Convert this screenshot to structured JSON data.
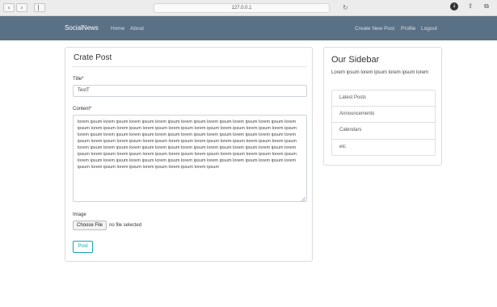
{
  "browser": {
    "url": "127.0.0.1",
    "back_glyph": "‹",
    "forward_glyph": "›",
    "reload_glyph": "↻",
    "icons": [
      "download-icon",
      "share-icon",
      "tabs-icon"
    ]
  },
  "navbar": {
    "brand": "SocialNews",
    "left_links": [
      "Home",
      "About"
    ],
    "right_links": [
      "Create New Post",
      "Profile",
      "Logout"
    ],
    "background": "#5a7085"
  },
  "form": {
    "heading": "Crate Post",
    "title_label": "Title*",
    "title_value": "TestT",
    "content_label": "Content*",
    "content_value": "lorem ipsum lorem ipsum lorem ipsum lorem ipsum lorem ipsum lorem ipsum lorem ipsum lorem ipsum lorem ipsum lorem ipsum lorem ipsum lorem ipsum lorem ipsum lorem ipsum lorem ipsum lorem ipsum lorem ipsum lorem ipsum lorem ipsum lorem ipsum lorem ipsum lorem ipsum lorem ipsum lorem ipsum lorem ipsum lorem ipsum lorem ipsum lorem ipsum lorem ipsum lorem ipsum lorem ipsum lorem ipsum lorem ipsum  lorem ipsum lorem ipsum lorem ipsum lorem ipsum lorem ipsum lorem ipsum lorem ipsum lorem ipsum lorem ipsum lorem ipsum lorem ipsum lorem ipsum lorem ipsum lorem ipsum lorem ipsum lorem ipsum lorem ipsum lorem ipsum lorem ipsum lorem ipsum lorem ipsum lorem ipsum lorem ipsum lorem ipsum lorem ipsum lorem ipsum lorem ipsum lorem ipsum lorem ipsum lorem ipsum lorem ipsum lorem ipsum",
    "image_label": "Image",
    "file_button": "Choose File",
    "file_status": "no file selected",
    "submit_label": "Post",
    "accent": "#17a2b8"
  },
  "sidebar": {
    "title": "Our Sidebar",
    "text": "Lorem ipsum lorem ipsum lorem ipsum lorem",
    "items": [
      "Latest Posts",
      "Announcements",
      "Calendars",
      "etc"
    ]
  }
}
